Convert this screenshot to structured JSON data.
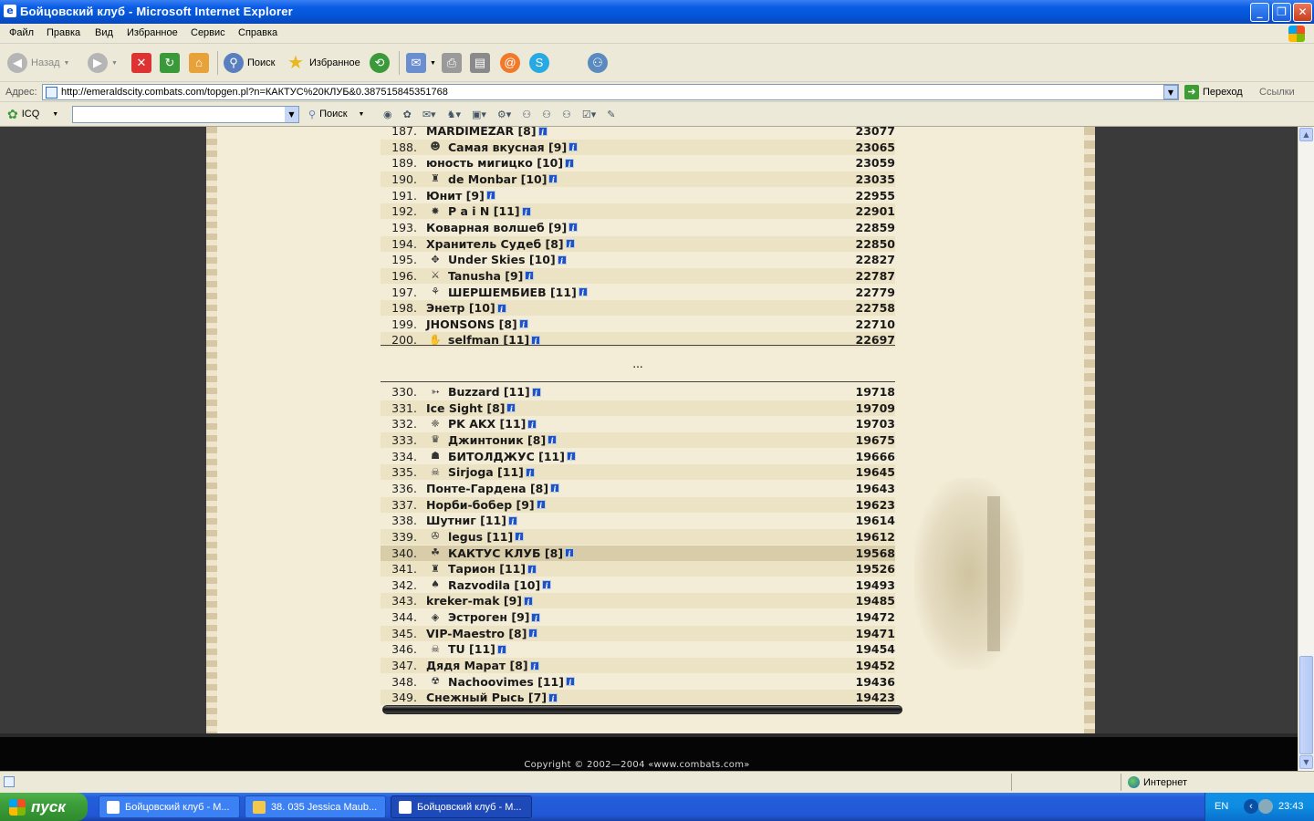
{
  "window": {
    "title": "Бойцовский клуб - Microsoft Internet Explorer"
  },
  "menu": [
    "Файл",
    "Правка",
    "Вид",
    "Избранное",
    "Сервис",
    "Справка"
  ],
  "toolbar": {
    "back": "Назад",
    "search": "Поиск",
    "favorites": "Избранное"
  },
  "address": {
    "label": "Адрес:",
    "url": "http://emeraldscity.combats.com/topgen.pl?n=КАКТУС%20КЛУБ&0.387515845351768",
    "go": "Переход",
    "links": "Ссылки"
  },
  "icqbar": {
    "icq": "ICQ",
    "search": "Поиск"
  },
  "ranking": {
    "top": [
      {
        "rank": "187.",
        "name": "MARDIMEZAR [8]",
        "score": "23077",
        "emblem": ""
      },
      {
        "rank": "188.",
        "name": "Самая вкусная [9]",
        "score": "23065",
        "emblem": "☻"
      },
      {
        "rank": "189.",
        "name": "юность мигицко [10]",
        "score": "23059",
        "emblem": ""
      },
      {
        "rank": "190.",
        "name": "de Monbar [10]",
        "score": "23035",
        "emblem": "♜"
      },
      {
        "rank": "191.",
        "name": "Юнит [9]",
        "score": "22955",
        "emblem": ""
      },
      {
        "rank": "192.",
        "name": "P a i N [11]",
        "score": "22901",
        "emblem": "✸"
      },
      {
        "rank": "193.",
        "name": "Коварная волшеб [9]",
        "score": "22859",
        "emblem": ""
      },
      {
        "rank": "194.",
        "name": "Хранитель Судеб [8]",
        "score": "22850",
        "emblem": ""
      },
      {
        "rank": "195.",
        "name": "Under Skies [10]",
        "score": "22827",
        "emblem": "✥"
      },
      {
        "rank": "196.",
        "name": "Tanusha [9]",
        "score": "22787",
        "emblem": "⚔"
      },
      {
        "rank": "197.",
        "name": "ШЕРШЕМБИЕВ [11]",
        "score": "22779",
        "emblem": "⚘"
      },
      {
        "rank": "198.",
        "name": "Энетр [10]",
        "score": "22758",
        "emblem": ""
      },
      {
        "rank": "199.",
        "name": "JHONSONS [8]",
        "score": "22710",
        "emblem": ""
      },
      {
        "rank": "200.",
        "name": "selfman [11]",
        "score": "22697",
        "emblem": "✋"
      }
    ],
    "ellipsis": "...",
    "bottom": [
      {
        "rank": "330.",
        "name": "Buzzard [11]",
        "score": "19718",
        "emblem": "➳"
      },
      {
        "rank": "331.",
        "name": "Ice Sight [8]",
        "score": "19709",
        "emblem": ""
      },
      {
        "rank": "332.",
        "name": "PK AKX [11]",
        "score": "19703",
        "emblem": "❈"
      },
      {
        "rank": "333.",
        "name": "Джинтоник [8]",
        "score": "19675",
        "emblem": "♛"
      },
      {
        "rank": "334.",
        "name": "БИТОЛДЖУС [11]",
        "score": "19666",
        "emblem": "☗"
      },
      {
        "rank": "335.",
        "name": "Sirjoga [11]",
        "score": "19645",
        "emblem": "☠"
      },
      {
        "rank": "336.",
        "name": "Понте-Гардена [8]",
        "score": "19643",
        "emblem": ""
      },
      {
        "rank": "337.",
        "name": "Норби-бобер [9]",
        "score": "19623",
        "emblem": ""
      },
      {
        "rank": "338.",
        "name": "Шутниг [11]",
        "score": "19614",
        "emblem": ""
      },
      {
        "rank": "339.",
        "name": "legus [11]",
        "score": "19612",
        "emblem": "✇"
      },
      {
        "rank": "340.",
        "name": "КАКТУС КЛУБ [8]",
        "score": "19568",
        "emblem": "☘",
        "highlight": true
      },
      {
        "rank": "341.",
        "name": "Тарион [11]",
        "score": "19526",
        "emblem": "♜"
      },
      {
        "rank": "342.",
        "name": "Razvodila [10]",
        "score": "19493",
        "emblem": "♠"
      },
      {
        "rank": "343.",
        "name": "kreker-mak [9]",
        "score": "19485",
        "emblem": ""
      },
      {
        "rank": "344.",
        "name": "Эстроген [9]",
        "score": "19472",
        "emblem": "◈"
      },
      {
        "rank": "345.",
        "name": "VIP-Maestro [8]",
        "score": "19471",
        "emblem": ""
      },
      {
        "rank": "346.",
        "name": "TU [11]",
        "score": "19454",
        "emblem": "☠"
      },
      {
        "rank": "347.",
        "name": "Дядя Марат [8]",
        "score": "19452",
        "emblem": ""
      },
      {
        "rank": "348.",
        "name": "Nachoovimes [11]",
        "score": "19436",
        "emblem": "☢"
      },
      {
        "rank": "349.",
        "name": "Снежный Рысь [7]",
        "score": "19423",
        "emblem": ""
      }
    ]
  },
  "footer": {
    "copyright": "Copyright © 2002—2004 «www.combats.com»"
  },
  "status": {
    "zone": "Интернет"
  },
  "taskbar": {
    "start": "пуск",
    "tasks": [
      "Бойцовский клуб - M...",
      "38. 035 Jessica Maub...",
      "Бойцовский клуб - M..."
    ],
    "lang": "EN",
    "time": "23:43"
  },
  "colors": {
    "parchment": "#f3ecd6",
    "xp_blue": "#0454d6",
    "highlight_row": "#d8cda8"
  }
}
